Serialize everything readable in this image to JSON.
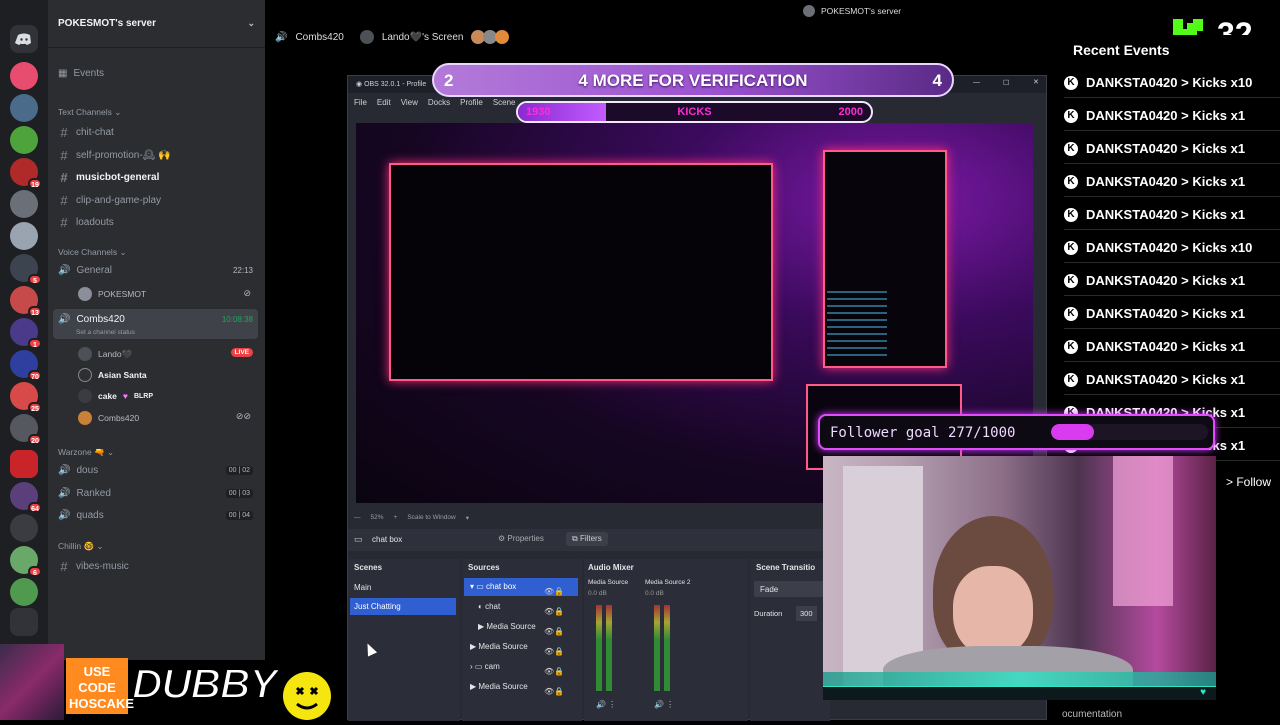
{
  "discord": {
    "server_name": "POKESMOT's server",
    "events_label": "Events",
    "text_category": "Text Channels",
    "text_channels": [
      "chit-chat",
      "self-promotion-🕰 🙌",
      "musicbot-general",
      "clip-and-game-play",
      "loadouts"
    ],
    "voice_category": "Voice Channels",
    "voice_general": {
      "name": "General",
      "timer": "22:13",
      "user": "POKESMOT"
    },
    "voice_combs": {
      "name": "Combs420",
      "timer": "10:08:38",
      "status": "Set a channel status"
    },
    "voice_users": [
      "Lando🖤",
      "Asian Santa",
      "cake",
      "Combs420"
    ],
    "live_badge": "LIVE",
    "cake_tag": "BLRP",
    "warzone_category": "Warzone 🔫",
    "warzone_channels": [
      {
        "name": "dous",
        "a": "00",
        "b": "02"
      },
      {
        "name": "Ranked",
        "a": "00",
        "b": "03"
      },
      {
        "name": "quads",
        "a": "00",
        "b": "04"
      }
    ],
    "chillin_category": "Chillin 🤓",
    "chillin_channels": [
      "vibes-music"
    ],
    "server_badges": [
      "19",
      "5",
      "13",
      "1",
      "70",
      "25",
      "20",
      "6",
      "64"
    ],
    "top_channel": "Combs420",
    "top_stream": "Lando🖤's Screen",
    "top_server": "POKESMOT's server"
  },
  "obs": {
    "title": "OBS 32.0.1 - Profile",
    "menu": [
      "File",
      "Edit",
      "View",
      "Docks",
      "Profile",
      "Scene"
    ],
    "zoom": "52%",
    "scale": "Scale to Window",
    "selected_source": "chat box",
    "properties_label": "Properties",
    "filters_label": "Filters",
    "scenes_title": "Scenes",
    "scenes": [
      "Main",
      "Just Chatting"
    ],
    "sources_title": "Sources",
    "sources": [
      "chat box",
      "chat",
      "Media Source",
      "Media Source",
      "cam",
      "Media Source"
    ],
    "mixer_title": "Audio Mixer",
    "mixer_channels": [
      {
        "name": "Media Source",
        "db": "0.0 dB"
      },
      {
        "name": "Media Source 2",
        "db": "0.0 dB"
      }
    ],
    "transition_title": "Scene Transitio",
    "transition": "Fade",
    "duration_label": "Duration",
    "duration_value": "300"
  },
  "overlay": {
    "verif_left": "2",
    "verif_text": "4 MORE FOR VERIFICATION",
    "verif_right": "4",
    "kicks_start": "1930",
    "kicks_label": "KICKS",
    "kicks_end": "2000",
    "kicks_progress": 0.25,
    "kick_count": "32",
    "events_title": "Recent Events",
    "events": [
      "DANKSTA0420 > Kicks x10",
      "DANKSTA0420 > Kicks x1",
      "DANKSTA0420 > Kicks x1",
      "DANKSTA0420 > Kicks x1",
      "DANKSTA0420 > Kicks x1",
      "DANKSTA0420 > Kicks x10",
      "DANKSTA0420 > Kicks x1",
      "DANKSTA0420 > Kicks x1",
      "DANKSTA0420 > Kicks x1",
      "DANKSTA0420 > Kicks x1",
      "DANKSTA0420 > Kicks x1",
      "DANKSTA0420 > Kicks x1"
    ],
    "follow_label": "> Follow",
    "follower_goal": "Follower goal 277/1000",
    "follower_progress": 0.277,
    "sponsor_code": "USE CODE HOSCAKE",
    "sponsor_brand": "DUBBY",
    "bottom_fragment": "ocumentation"
  },
  "colors": {
    "discord_bg": "#2b2d31",
    "rail_bg": "#1e1f22",
    "kick_green": "#53fc18",
    "neon_pink": "#e14cff",
    "live_red": "#ed4245"
  }
}
